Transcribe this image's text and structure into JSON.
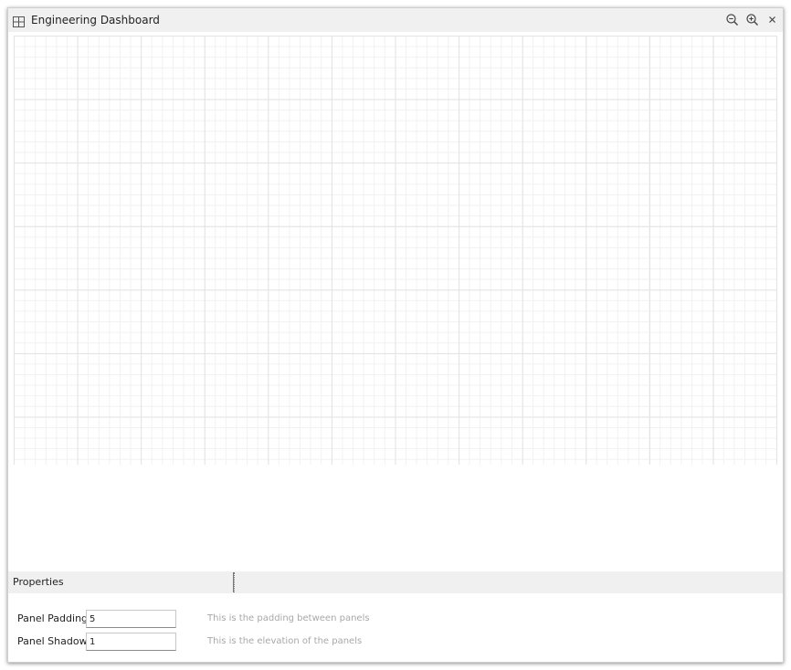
{
  "window": {
    "title": "Engineering Dashboard",
    "buttons": {
      "zoom_out": "zoom-out-icon",
      "zoom_in": "zoom-in-icon",
      "close": "close-icon"
    }
  },
  "properties": {
    "header": "Properties",
    "rows": [
      {
        "label": "Panel Padding",
        "value": "5",
        "description": "This is the padding between panels"
      },
      {
        "label": "Panel Shadow",
        "value": "1",
        "description": "This is the elevation of the panels"
      }
    ]
  },
  "colors": {
    "titlebar_bg": "#f0f0f0",
    "grid_major": "#e3e3e3",
    "grid_minor": "#f1f1f1",
    "description_text": "#a8a8a8"
  }
}
